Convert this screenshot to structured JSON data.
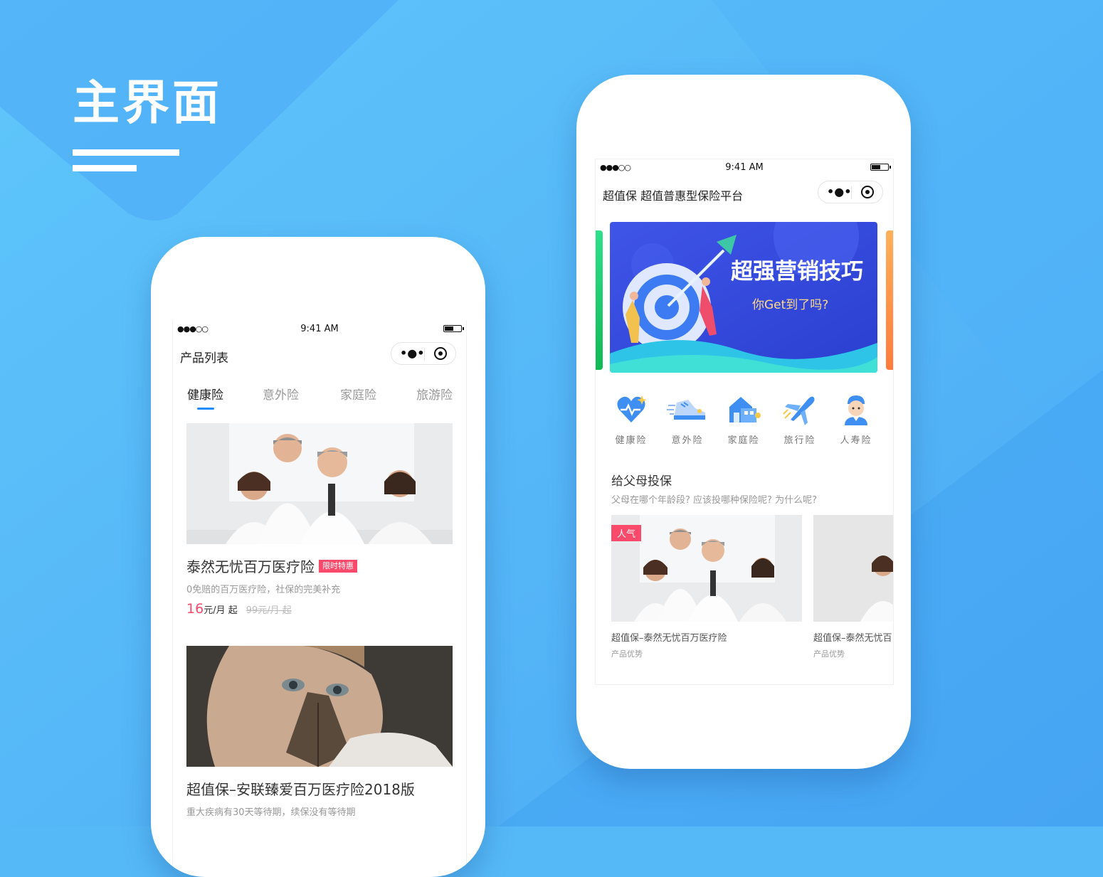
{
  "headline": "主界面",
  "left_phone": {
    "status": {
      "time": "9:41 AM"
    },
    "nav_title": "产品列表",
    "tabs": [
      {
        "label": "健康险",
        "active": true
      },
      {
        "label": "意外险",
        "active": false
      },
      {
        "label": "家庭险",
        "active": false
      },
      {
        "label": "旅游险",
        "active": false
      }
    ],
    "products": [
      {
        "title": "泰然无忧百万医疗险",
        "badge": "限时特惠",
        "desc": "0免赔的百万医疗险，社保的完美补充",
        "price": "16",
        "price_unit": "元/月 起",
        "price_old": "99元/月 起"
      },
      {
        "title": "超值保–安联臻爱百万医疗险2018版",
        "desc": "重大疾病有30天等待期，续保没有等待期"
      }
    ]
  },
  "right_phone": {
    "status": {
      "time": "9:41 AM"
    },
    "nav_title": "超值保  超值普惠型保险平台",
    "banner": {
      "headline": "超强营销技巧",
      "subline": "你Get到了吗?"
    },
    "categories": [
      {
        "label": "健康险",
        "icon": "heart-icon"
      },
      {
        "label": "意外险",
        "icon": "sneaker-icon"
      },
      {
        "label": "家庭险",
        "icon": "house-icon"
      },
      {
        "label": "旅行险",
        "icon": "airplane-icon"
      },
      {
        "label": "人寿险",
        "icon": "person-icon"
      }
    ],
    "section": {
      "title": "给父母投保",
      "subtitle": "父母在哪个年龄段? 应该投哪种保险呢? 为什么呢?"
    },
    "cards": [
      {
        "tag": "人气",
        "title": "超值保–泰然无忧百万医疗险",
        "sub": "产品优势"
      },
      {
        "title": "超值保–泰然无忧百",
        "sub": "产品优势"
      }
    ]
  },
  "colors": {
    "accent": "#1a8cff",
    "price": "#fa4a6b",
    "background": "#56b9f7"
  }
}
